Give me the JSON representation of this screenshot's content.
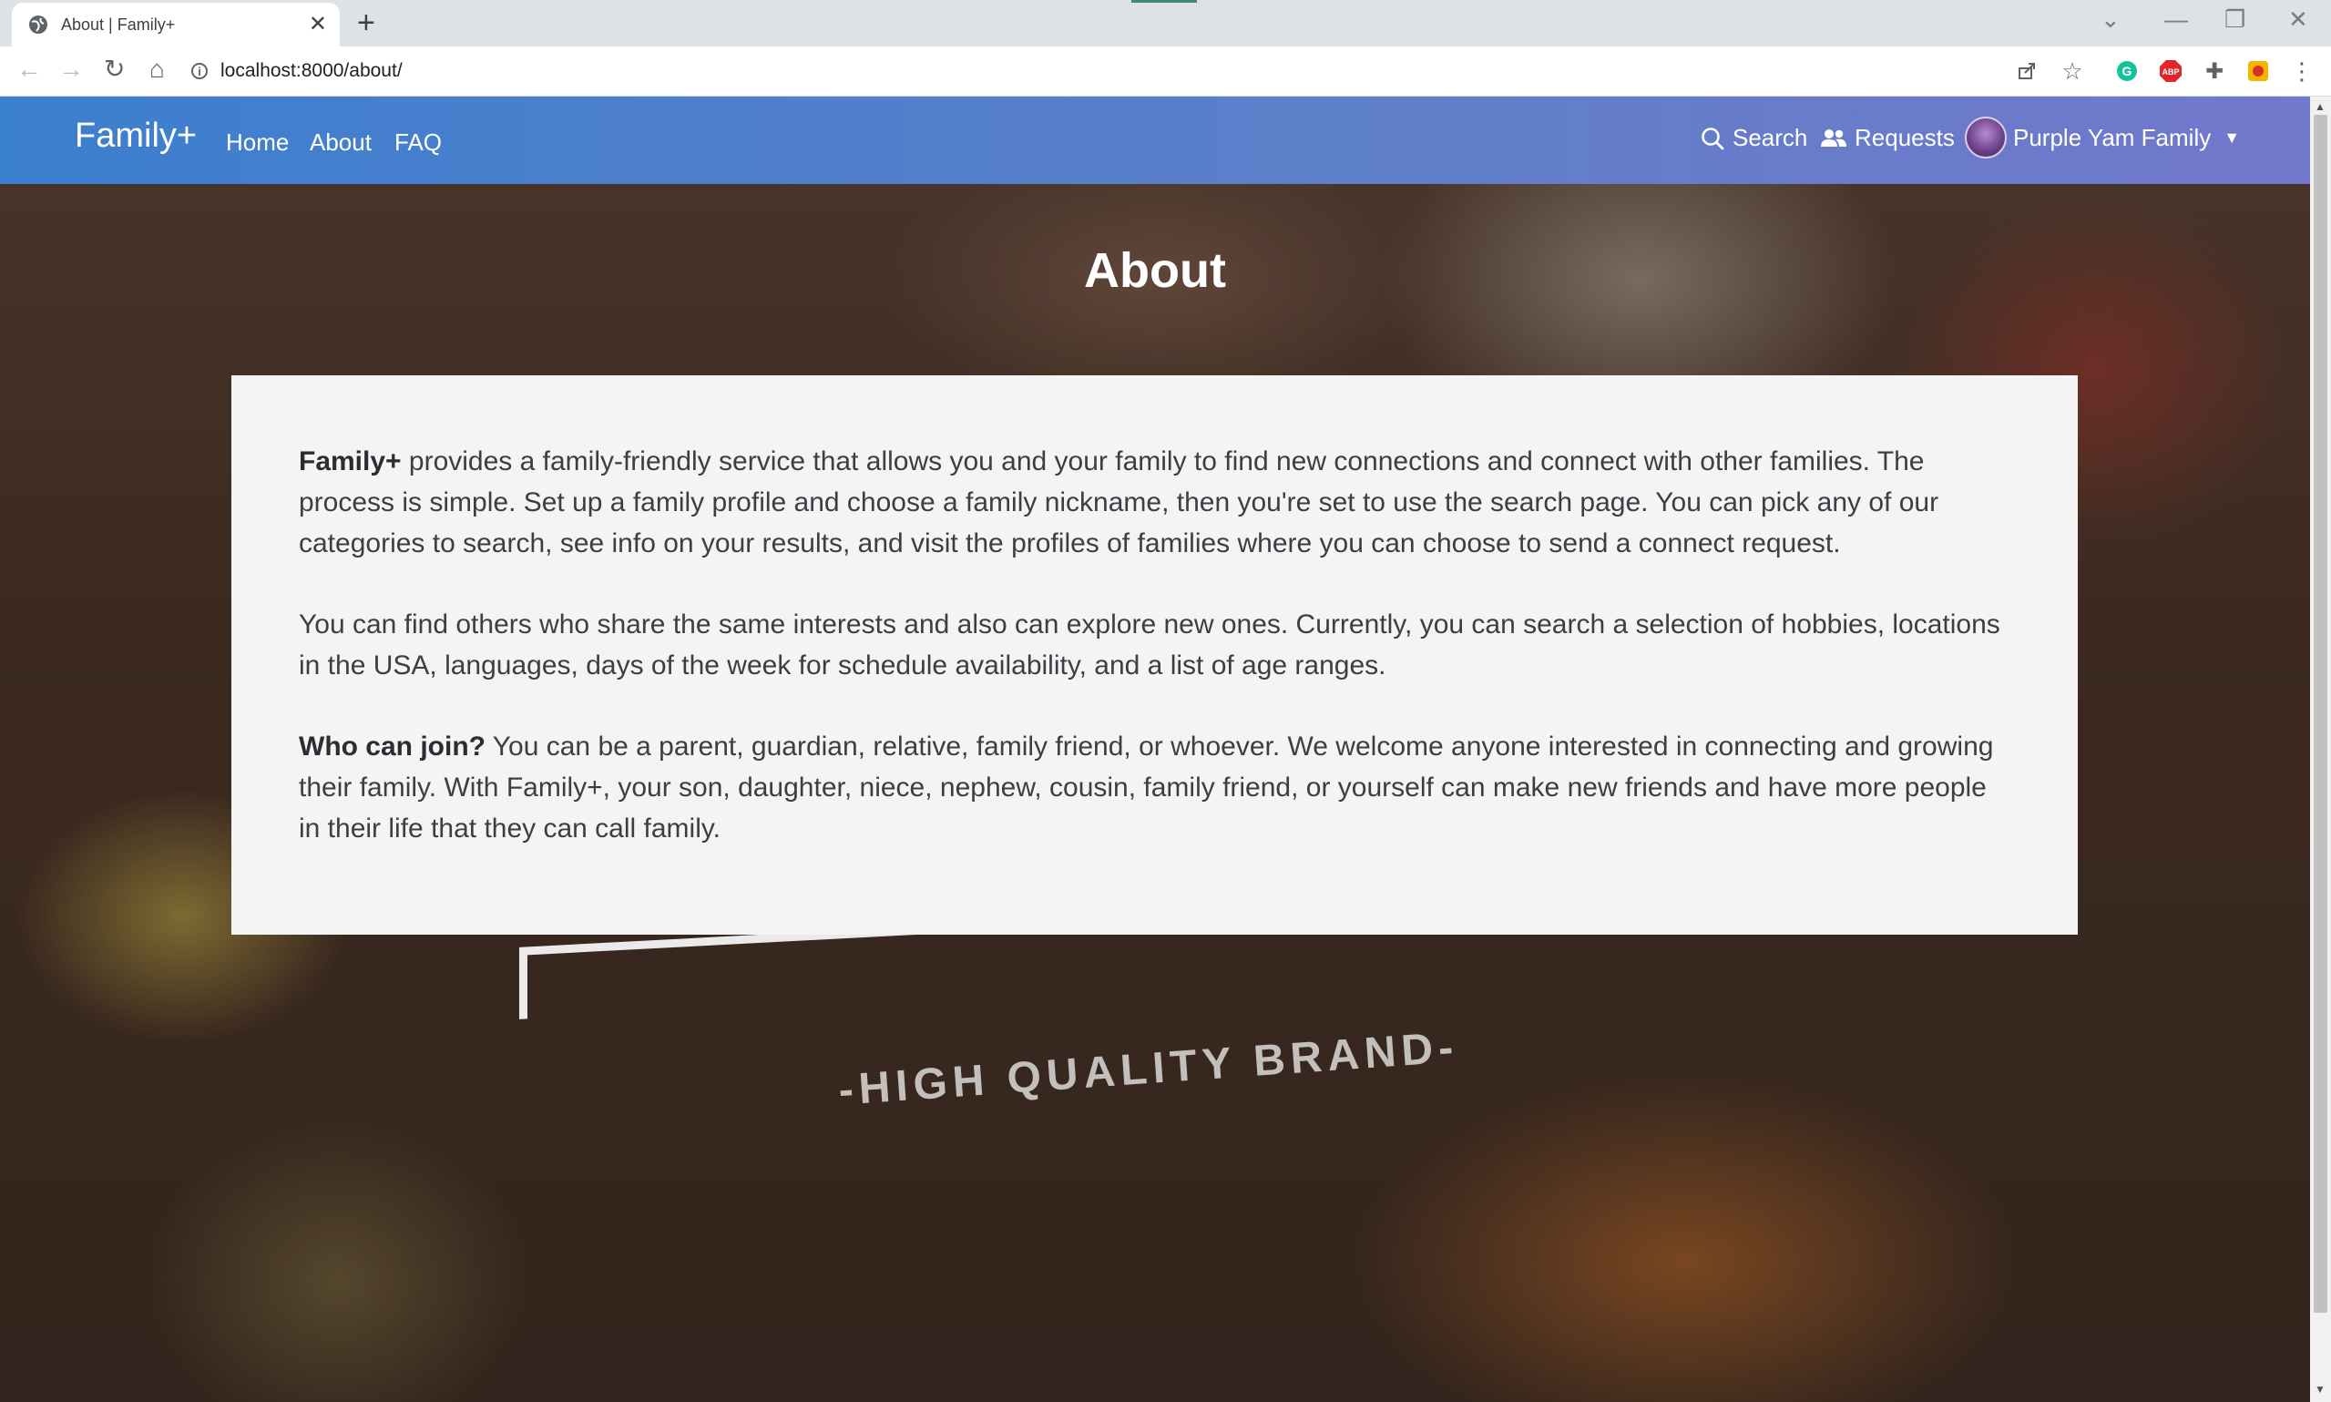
{
  "browser": {
    "tab_title": "About | Family+",
    "new_tab": "+",
    "url": "localhost:8000/about/"
  },
  "navbar": {
    "brand": "Family+",
    "links": [
      "Home",
      "About",
      "FAQ"
    ],
    "search": "Search",
    "requests": "Requests",
    "account": "Purple Yam Family"
  },
  "hero": {
    "title": "About"
  },
  "about": {
    "p1_bold": "Family+",
    "p1": " provides a family-friendly service that allows you and your family to find new connections and connect with other families. The process is simple. Set up a family profile and choose a family nickname, then you're set to use the search page. You can pick any of our categories to search, see info on your results, and visit the profiles of families where you can choose to send a connect request.",
    "p2": "You can find others who share the same interests and also can explore new ones. Currently, you can search a selection of hobbies, locations in the USA, languages, days of the week for schedule availability, and a list of age ranges.",
    "p3_bold": "Who can join?",
    "p3": " You can be a parent, guardian, relative, family friend, or whoever. We welcome anyone interested in connecting and growing their family. With Family+, your son, daughter, niece, nephew, cousin, family friend, or yourself can make new friends and have more people in their life that they can call family."
  },
  "background": {
    "brand_text": "-HIGH QUALITY BRAND-"
  },
  "colors": {
    "navbar_start": "#3b7fcf",
    "navbar_end": "#7278cc",
    "card_bg": "#f4f4f4"
  }
}
